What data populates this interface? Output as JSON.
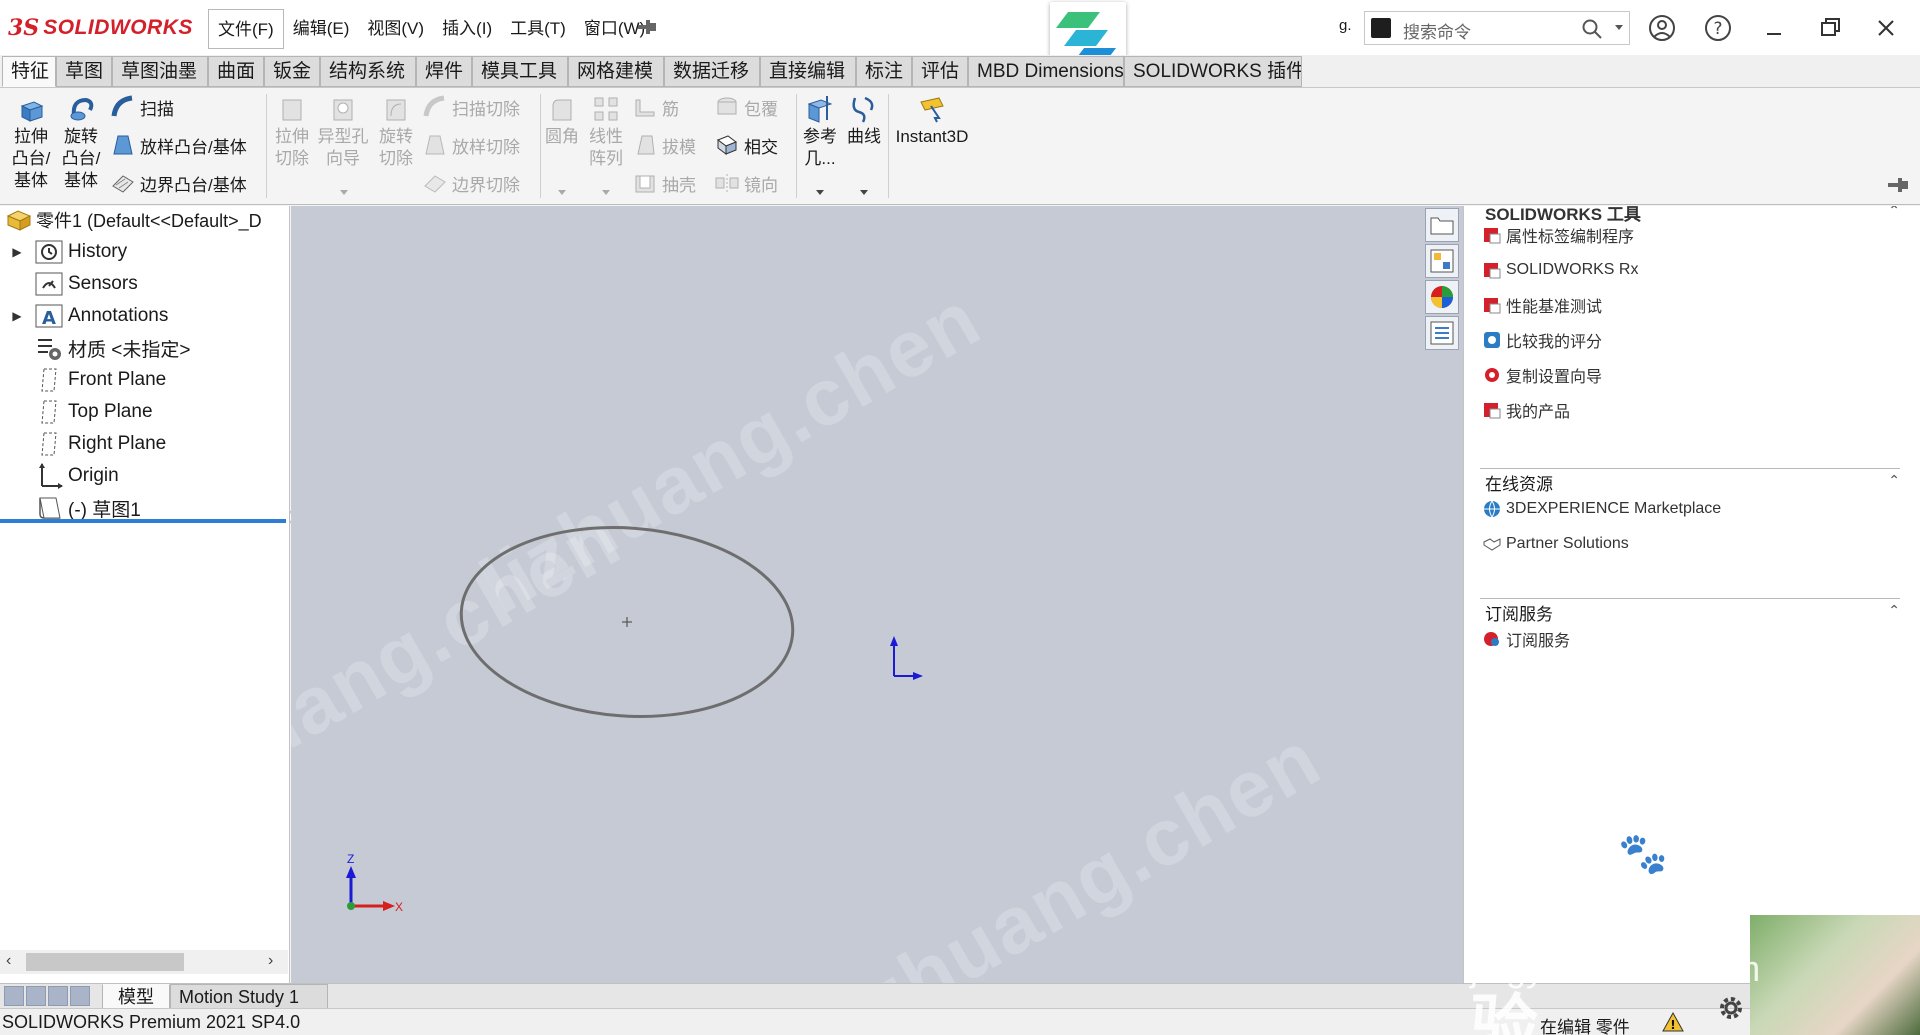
{
  "app": {
    "logo_ds": "3S",
    "logo_name": "SOLIDWORKS",
    "menus": [
      "文件(F)",
      "编辑(E)",
      "视图(V)",
      "插入(I)",
      "工具(T)",
      "窗口(W)"
    ],
    "search_placeholder": "搜索命令",
    "recent_label": "g."
  },
  "tabs": [
    "特征",
    "草图",
    "草图油墨",
    "曲面",
    "钣金",
    "结构系统",
    "焊件",
    "模具工具",
    "网格建模",
    "数据迁移",
    "直接编辑",
    "标注",
    "评估",
    "MBD Dimensions",
    "SOLIDWORKS 插件"
  ],
  "ribbon": {
    "extrude_boss": [
      "拉伸",
      "凸台/",
      "基体"
    ],
    "revolve_boss": [
      "旋转",
      "凸台/",
      "基体"
    ],
    "sweep": "扫描",
    "loft": "放样凸台/基体",
    "boundary": "边界凸台/基体",
    "extrude_cut": [
      "拉伸",
      "切除"
    ],
    "hole_wizard": [
      "异型孔",
      "向导"
    ],
    "revolve_cut": [
      "旋转",
      "切除"
    ],
    "swept_cut": "扫描切除",
    "lofted_cut": "放样切除",
    "boundary_cut": "边界切除",
    "fillet": "圆角",
    "linear_pattern": [
      "线性",
      "阵列"
    ],
    "rib": "筋",
    "draft": "拔模",
    "shell": "抽壳",
    "wrap": "包覆",
    "intersect": "相交",
    "mirror": "镜向",
    "ref_geometry": [
      "参考",
      "几..."
    ],
    "curves": "曲线",
    "instant3d": "Instant3D"
  },
  "tree": {
    "root": "零件1  (Default<<Default>_D",
    "items": [
      "History",
      "Sensors",
      "Annotations",
      "材质 <未指定>",
      "Front Plane",
      "Top Plane",
      "Right Plane",
      "Origin",
      "(-) 草图1"
    ]
  },
  "graphics": {
    "triad_z": "Z",
    "triad_x": "X",
    "watermark": "lizhuang.chen"
  },
  "taskpane": {
    "tools_header": "SOLIDWORKS 工具",
    "tools": [
      "属性标签编制程序",
      "SOLIDWORKS Rx",
      "性能基准测试",
      "比较我的评分",
      "复制设置向导",
      "我的产品"
    ],
    "online_header": "在线资源",
    "online": [
      "3DEXPERIENCE Marketplace",
      "Partner Solutions"
    ],
    "subscription_header": "订阅服务",
    "subscription": [
      "订阅服务"
    ]
  },
  "bottom_tabs": [
    "模型",
    "Motion Study 1"
  ],
  "status": {
    "left": "SOLIDWORKS Premium 2021 SP4.0",
    "right": "在编辑 零件"
  },
  "overlay": {
    "baidu": "Bai du 经验",
    "baidu_url": "jingyan.baidu.com"
  },
  "colors": {
    "brand_red": "#d4202a",
    "viewport_bg": "#c5cad4",
    "selection_blue": "#2e7dd6"
  }
}
